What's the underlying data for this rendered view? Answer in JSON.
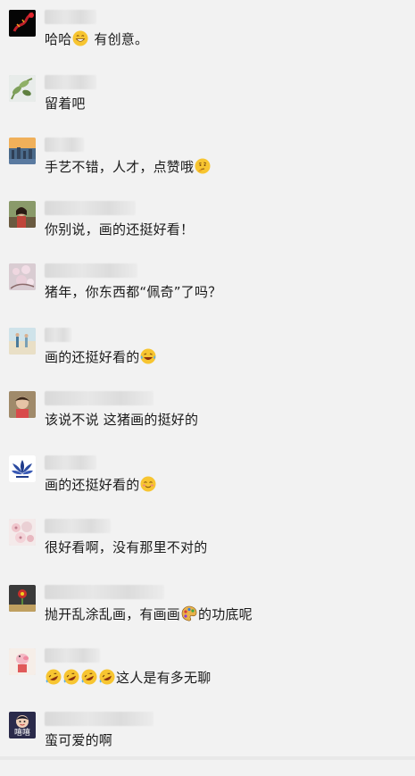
{
  "comments": [
    {
      "avatar_icon": "dragon-avatar-icon",
      "text_before": "哈哈",
      "emoji": "grin-emoji-icon",
      "text_after": " 有创意。"
    },
    {
      "avatar_icon": "plant-avatar-icon",
      "text_before": "留着吧",
      "emoji": "",
      "text_after": ""
    },
    {
      "avatar_icon": "city-sunset-avatar-icon",
      "text_before": "手艺不错，人才，点赞哦",
      "emoji": "thinking-emoji-icon",
      "text_after": ""
    },
    {
      "avatar_icon": "woman-outdoor-avatar-icon",
      "text_before": "你别说，画的还挺好看！",
      "emoji": "",
      "text_after": ""
    },
    {
      "avatar_icon": "blossom-avatar-icon",
      "text_before": "猪年，你东西都“佩奇”了吗？",
      "emoji": "",
      "text_after": ""
    },
    {
      "avatar_icon": "beach-avatar-icon",
      "text_before": "画的还挺好看的",
      "emoji": "laughing-tears-emoji-icon",
      "text_after": ""
    },
    {
      "avatar_icon": "child-avatar-icon",
      "text_before": "该说不说 这猪画的挺好的",
      "emoji": "",
      "text_after": ""
    },
    {
      "avatar_icon": "lotus-avatar-icon",
      "text_before": "画的还挺好看的",
      "emoji": "blush-emoji-icon",
      "text_after": ""
    },
    {
      "avatar_icon": "flowers-avatar-icon",
      "text_before": "很好看啊，没有那里不对的",
      "emoji": "",
      "text_after": ""
    },
    {
      "avatar_icon": "flower-dark-avatar-icon",
      "text_before": "抛开乱涂乱画，有画画",
      "emoji": "palette-emoji-icon",
      "text_after": "的功底呢"
    },
    {
      "avatar_icon": "pig-cartoon-avatar-icon",
      "text_before": "",
      "emoji": "rofl-emoji-icon",
      "emoji_count": 4,
      "text_after": "这人是有多无聊"
    },
    {
      "avatar_icon": "boy-cartoon-avatar-icon",
      "avatar_label": "嘻嘻",
      "text_before": "蛮可爱的啊",
      "emoji": "",
      "text_after": ""
    }
  ]
}
